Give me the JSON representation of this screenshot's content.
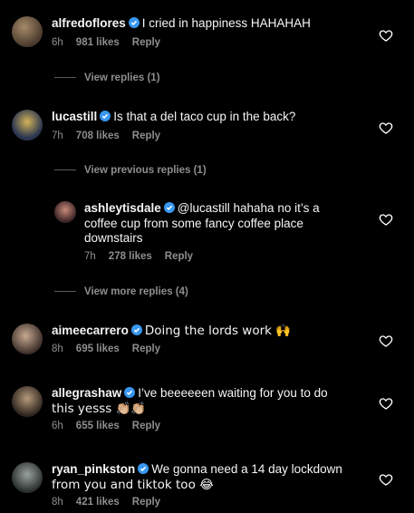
{
  "colors": {
    "background": "#000000",
    "text": "#f5f5f5",
    "muted": "#8e8e8e",
    "verified": "#3897f0"
  },
  "comments": [
    {
      "username": "alfredoflores",
      "text": "I cried in happiness HAHAHAH",
      "time": "6h",
      "likes": "981 likes",
      "reply": "Reply",
      "view_replies": "View replies (1)"
    },
    {
      "username": "lucastill",
      "text": "Is that a del taco cup in the back?",
      "time": "7h",
      "likes": "708 likes",
      "reply": "Reply",
      "view_replies": "View previous replies (1)"
    },
    {
      "username": "ashleytisdale",
      "text_line1": "@lucastill hahaha no it’s a",
      "text_line2": "coffee cup from some fancy coffee place",
      "text_line3": "downstairs",
      "time": "7h",
      "likes": "278 likes",
      "reply": "Reply",
      "view_replies": "View more replies (4)"
    },
    {
      "username": "aimeecarrero",
      "text": "Doing the lords work 🙌",
      "time": "8h",
      "likes": "695 likes",
      "reply": "Reply"
    },
    {
      "username": "allegrashaw",
      "text": "I’ve beeeeeen waiting for you to do",
      "text_line2": "this yesss 👏🏼👏🏼",
      "time": "6h",
      "likes": "655 likes",
      "reply": "Reply"
    },
    {
      "username": "ryan_pinkston",
      "text": "We gonna need a 14 day lockdown",
      "text_line2": "from you and tiktok too 😂",
      "time": "8h",
      "likes": "421 likes",
      "reply": "Reply"
    }
  ],
  "icons": {
    "like": "heart-outline-icon",
    "verified": "verified-badge-icon"
  }
}
